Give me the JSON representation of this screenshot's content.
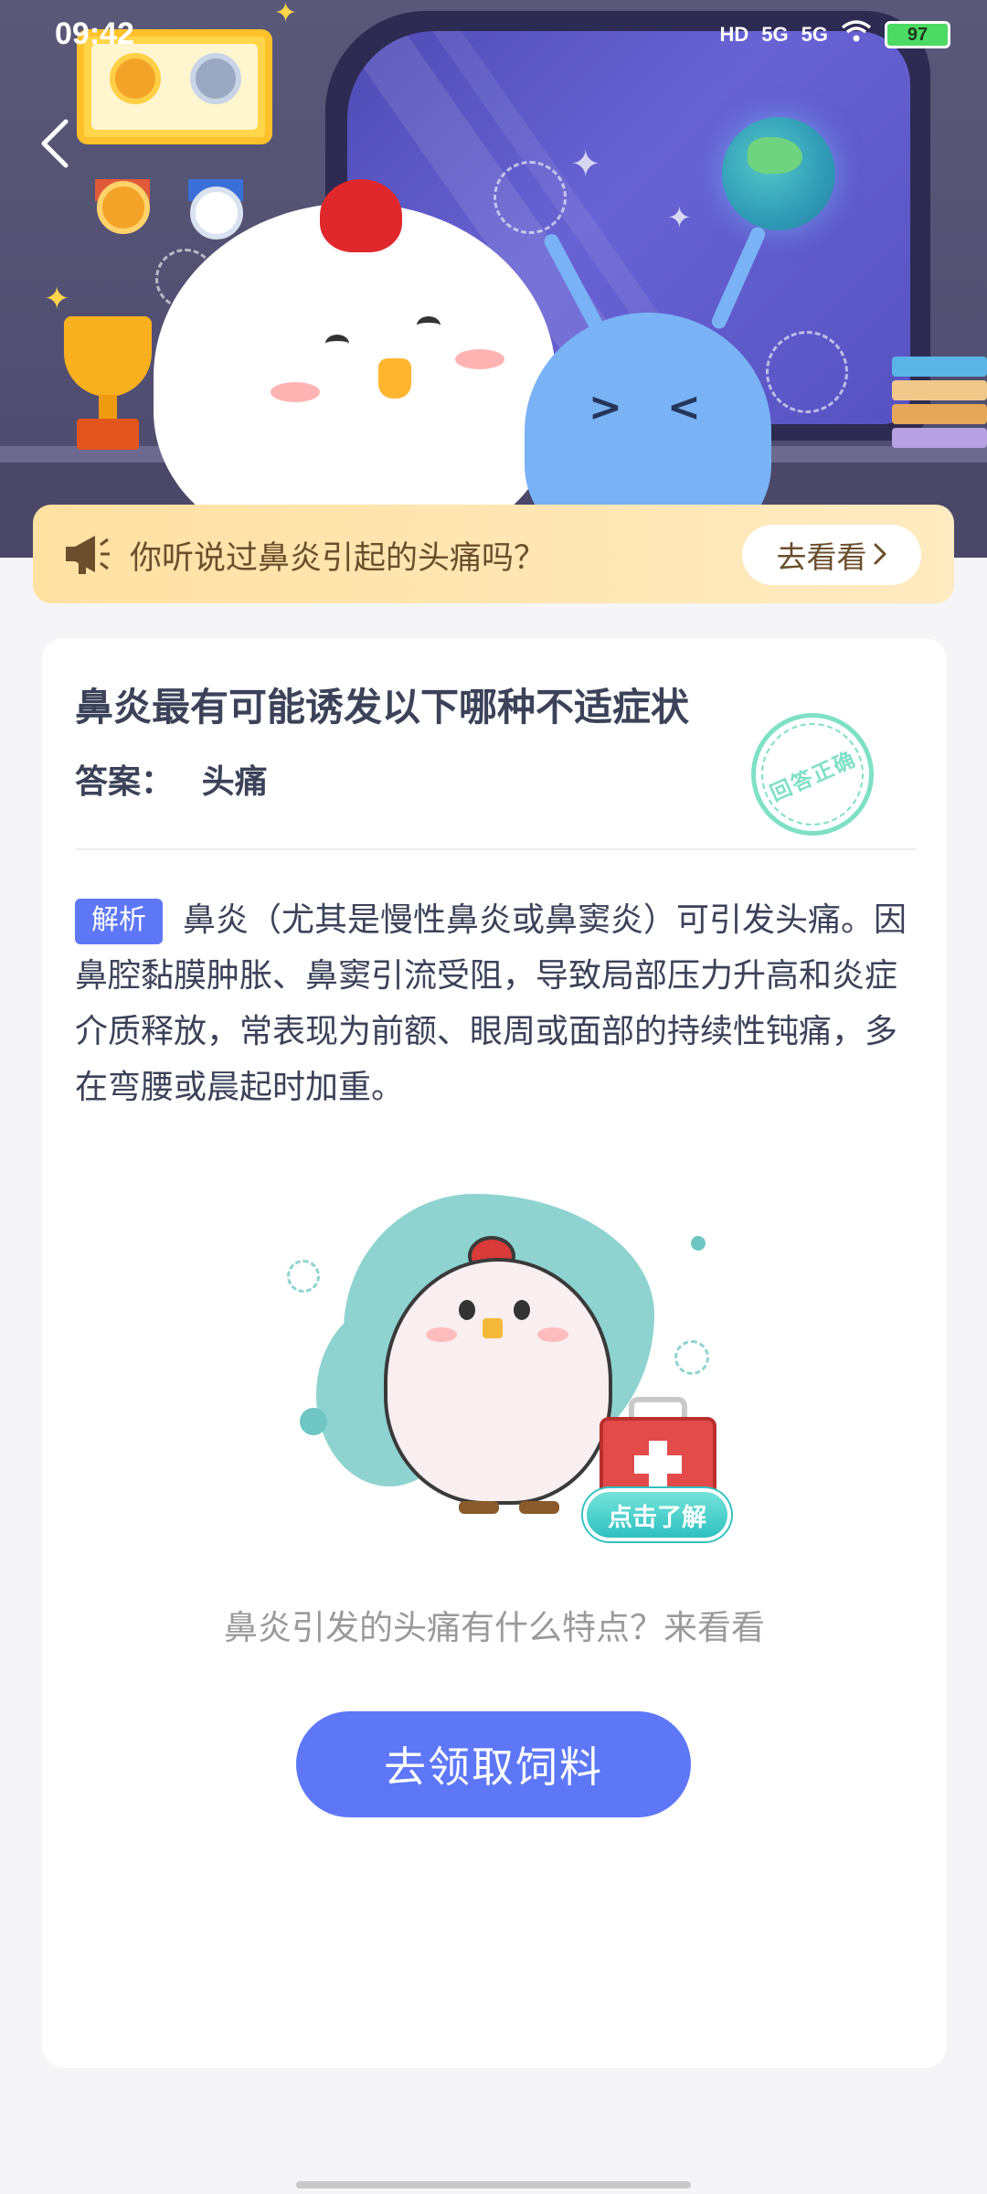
{
  "status_bar": {
    "time": "09:42",
    "network_1": "5G",
    "network_2": "5G",
    "hd_label": "HD",
    "battery": "97"
  },
  "header": {
    "back_icon": "chevron-left-icon"
  },
  "notice": {
    "icon": "megaphone-icon",
    "text": "你听说过鼻炎引起的头痛吗？",
    "button_label": "去看看",
    "button_icon": "chevron-right-icon"
  },
  "question": {
    "title": "鼻炎最有可能诱发以下哪种不适症状",
    "answer_label": "答案：",
    "answer_value": "头痛",
    "stamp_text": "回答正确"
  },
  "analysis": {
    "tag": "解析",
    "text": "鼻炎（尤其是慢性鼻炎或鼻窦炎）可引发头痛。因鼻腔黏膜肿胀、鼻窦引流受阻，导致局部压力升高和炎症介质释放，常表现为前额、眼周或面部的持续性钝痛，多在弯腰或晨起时加重。"
  },
  "illustration": {
    "button_label": "点击了解",
    "caption": "鼻炎引发的头痛有什么特点？来看看"
  },
  "cta": {
    "label": "去领取饲料"
  },
  "colors": {
    "accent": "#5d77f7",
    "notice_bg": "#ffe1a2",
    "stamp": "#7fe0c6",
    "teal": "#2fc1c0"
  }
}
